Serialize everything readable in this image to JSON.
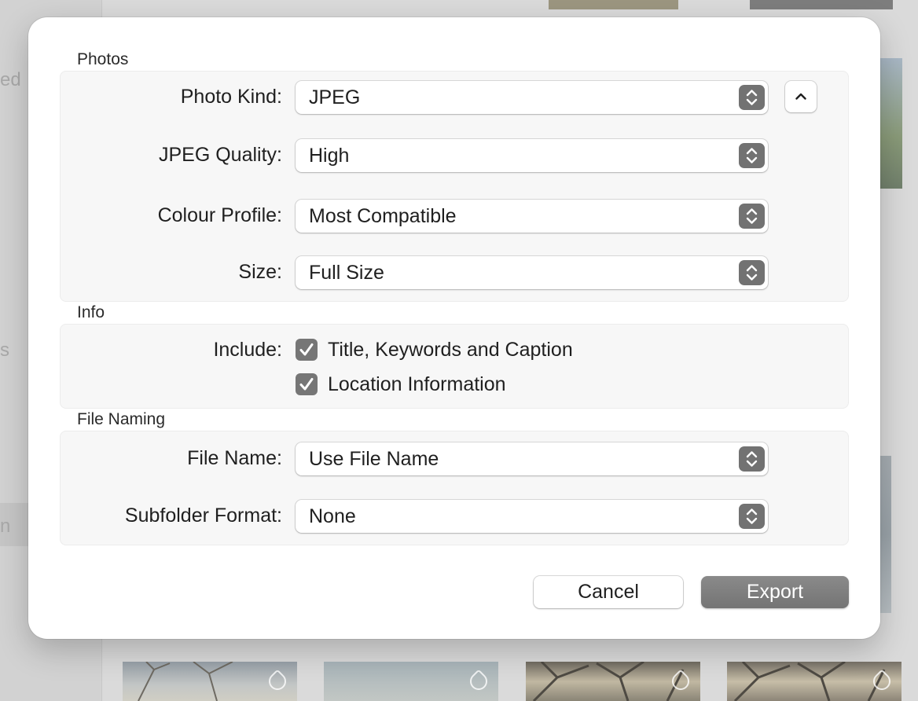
{
  "background": {
    "sidebar_fragments": [
      "ed",
      "s",
      "n"
    ]
  },
  "dialog": {
    "sections": {
      "photos": {
        "title": "Photos"
      },
      "info": {
        "title": "Info"
      },
      "file_naming": {
        "title": "File Naming"
      }
    },
    "photo_kind": {
      "label": "Photo Kind:",
      "value": "JPEG"
    },
    "jpeg_quality": {
      "label": "JPEG Quality:",
      "value": "High"
    },
    "colour_profile": {
      "label": "Colour Profile:",
      "value": "Most Compatible"
    },
    "size": {
      "label": "Size:",
      "value": "Full Size"
    },
    "include": {
      "label": "Include:",
      "options": [
        {
          "label": "Title, Keywords and Caption",
          "checked": true
        },
        {
          "label": "Location Information",
          "checked": true
        }
      ]
    },
    "file_name": {
      "label": "File Name:",
      "value": "Use File Name"
    },
    "subfolder_format": {
      "label": "Subfolder Format:",
      "value": "None"
    },
    "buttons": {
      "cancel": "Cancel",
      "export": "Export"
    }
  },
  "icons": {
    "popup": "up-down-chevron-icon",
    "disclosure": "chevron-up-icon",
    "check": "checkmark-icon",
    "tag": "tag-icon"
  },
  "colors": {
    "dialog_bg": "#ffffff",
    "group_bg": "#f7f7f7",
    "control_accent": "#727272",
    "dimmed_background": "#d9d9d9"
  }
}
